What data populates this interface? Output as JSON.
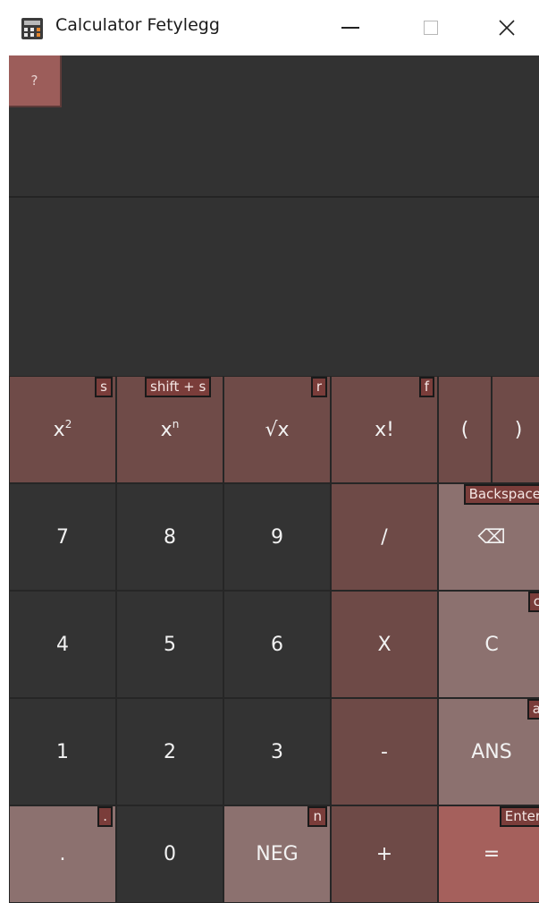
{
  "window": {
    "title": "Calculator Fetylegg",
    "minimize_glyph": "—",
    "close_glyph": "✕"
  },
  "display": {
    "help_label": "?",
    "expression": "",
    "result": ""
  },
  "keys": {
    "square": {
      "base": "x",
      "sup": "2",
      "hint": "s"
    },
    "power": {
      "base": "x",
      "sup": "n",
      "hint": "shift + s"
    },
    "sqrt": {
      "label": "√x",
      "hint": "r"
    },
    "factorial": {
      "label": "x!",
      "hint": "f"
    },
    "paren_open": {
      "label": "("
    },
    "paren_close": {
      "label": ")"
    },
    "seven": {
      "label": "7"
    },
    "eight": {
      "label": "8"
    },
    "nine": {
      "label": "9"
    },
    "divide": {
      "label": "/"
    },
    "backspace": {
      "label": "⌫",
      "hint": "Backspace"
    },
    "four": {
      "label": "4"
    },
    "five": {
      "label": "5"
    },
    "six": {
      "label": "6"
    },
    "multiply": {
      "label": "X"
    },
    "clear": {
      "label": "C",
      "hint": "c"
    },
    "one": {
      "label": "1"
    },
    "two": {
      "label": "2"
    },
    "three": {
      "label": "3"
    },
    "minus": {
      "label": "-"
    },
    "ans": {
      "label": "ANS",
      "hint": "a"
    },
    "decimal": {
      "label": ".",
      "hint": "."
    },
    "zero": {
      "label": "0"
    },
    "neg": {
      "label": "NEG",
      "hint": "n"
    },
    "plus": {
      "label": "+"
    },
    "equals": {
      "label": "=",
      "hint": "Enter"
    }
  },
  "colors": {
    "display_bg": "#323232",
    "digit_key": "#333333",
    "function_key": "#6f4b48",
    "grey_key": "#8c716f",
    "equals_key": "#a5605c",
    "hint_badge": "#7a3d3a"
  }
}
